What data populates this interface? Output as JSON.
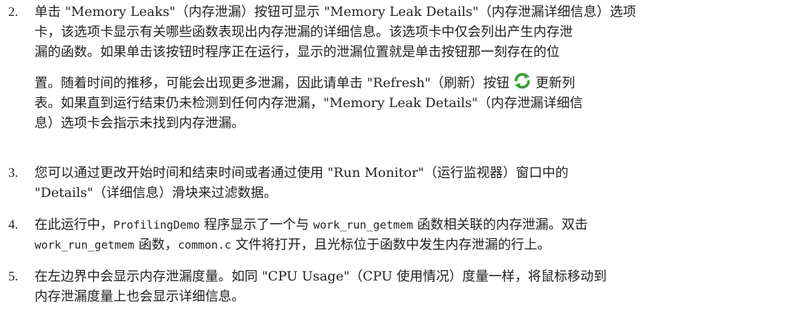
{
  "items": [
    {
      "number": "2.",
      "lines": [
        "单击 \"Memory Leaks\"（内存泄漏）按钮可显示 \"Memory Leak Details\"（内存泄漏详细信息）选项",
        "卡，该选项卡显示有关哪些函数表现出内存泄漏的详细信息。该选项卡中仅会列出产生内存泄",
        "漏的函数。如果单击该按钮时程序正在运行，显示的泄漏位置就是单击按钮那一刻存在的位"
      ],
      "line4_before_icon": "置。随着时间的推移，可能会出现更多泄漏，因此请单击 \"Refresh\"（刷新）按钮",
      "line4_after_icon": "更新列",
      "lines_after": [
        "表。如果直到运行结束仍未检测到任何内存泄漏，\"Memory Leak Details\"（内存泄漏详细信",
        "息）选项卡会指示未找到内存泄漏。"
      ],
      "icon": "refresh-icon"
    },
    {
      "number": "3.",
      "lines": [
        "您可以通过更改开始时间和结束时间或者通过使用 \"Run Monitor\"（运行监视器）窗口中的",
        "\"Details\"（详细信息）滑块来过滤数据。"
      ]
    },
    {
      "number": "4.",
      "l1a": "在此运行中，",
      "code_program": "ProfilingDemo",
      "l1b": "程序显示了一个与",
      "code_func": "work_run_getmem",
      "l1c": "函数相关联的内存泄漏。双击",
      "l2_code_func": "work_run_getmem",
      "l2a": "函数，",
      "code_file": "common.c",
      "l2b": "文件将打开，且光标位于函数中发生内存泄漏的行上。"
    },
    {
      "number": "5.",
      "lines": [
        "在左边界中会显示内存泄漏度量。如同 \"CPU Usage\"（CPU 使用情况）度量一样，将鼠标移动到",
        "内存泄漏度量上也会显示详细信息。"
      ]
    }
  ],
  "colors": {
    "text": "#222222",
    "icon_green": "#3aa63a",
    "icon_dark": "#1e6e1e"
  }
}
